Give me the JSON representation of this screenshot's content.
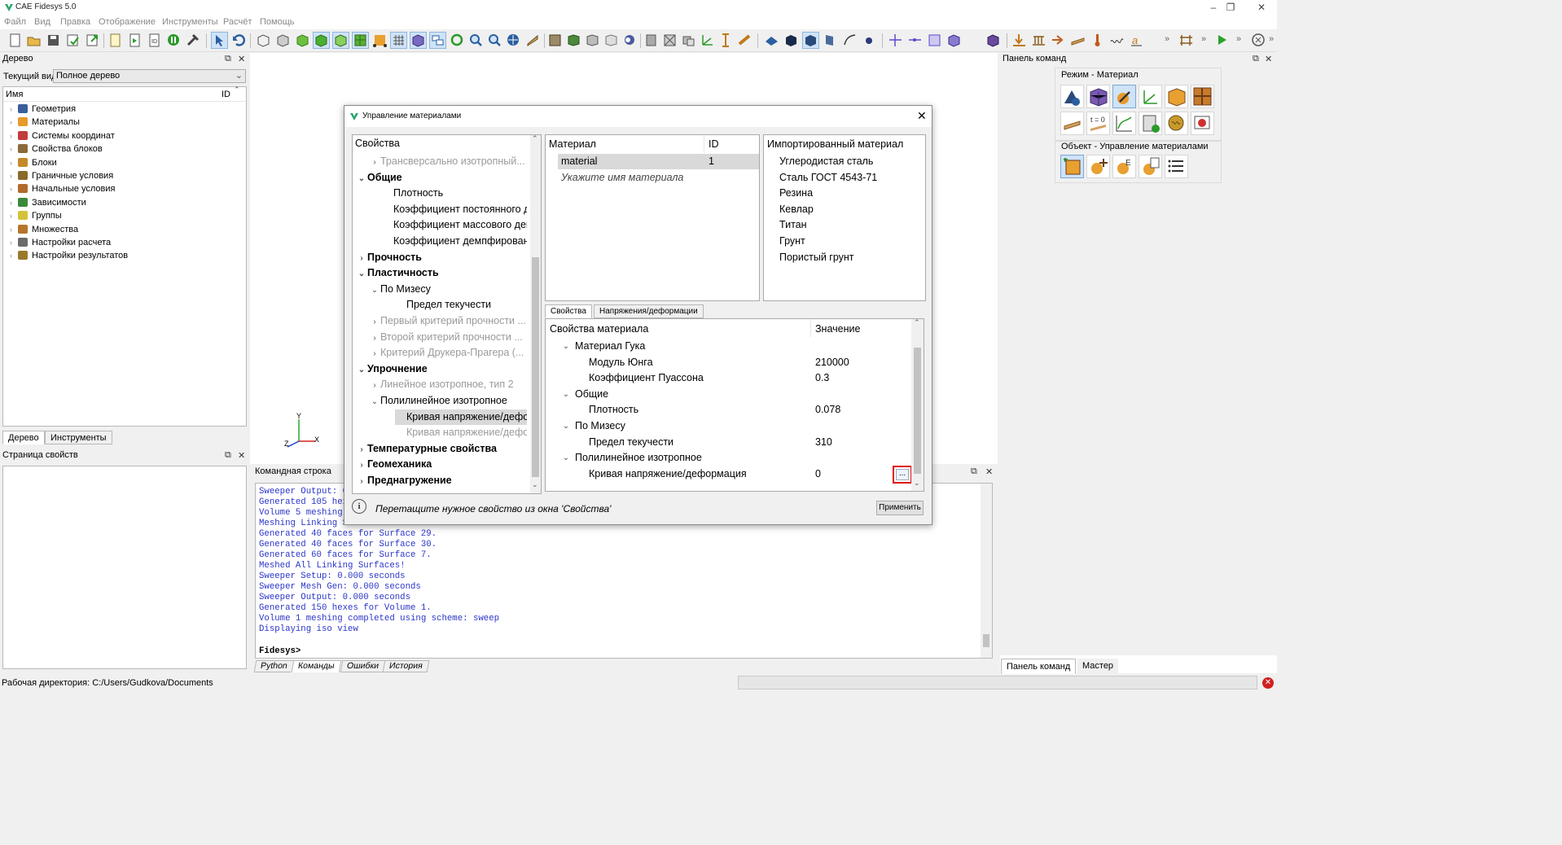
{
  "app": {
    "title": "CAE Fidesys 5.0"
  },
  "menu": [
    "Файл",
    "Вид",
    "Правка",
    "Отображение",
    "Инструменты",
    "Расчёт",
    "Помощь"
  ],
  "tree_dock": {
    "title": "Дерево",
    "current_view_label": "Текущий вид",
    "current_view_value": "Полное дерево",
    "col_name": "Имя",
    "col_id": "ID",
    "items": [
      {
        "label": "Геометрия",
        "icon": "geometry-icon",
        "color": "#3a5f9a"
      },
      {
        "label": "Материалы",
        "icon": "materials-icon",
        "color": "#e89a2a"
      },
      {
        "label": "Системы координат",
        "icon": "coord-system-icon",
        "color": "#c23b3b"
      },
      {
        "label": "Свойства блоков",
        "icon": "block-props-icon",
        "color": "#8a6a3a"
      },
      {
        "label": "Блоки",
        "icon": "blocks-icon",
        "color": "#c48a2a"
      },
      {
        "label": "Граничные условия",
        "icon": "boundary-icon",
        "color": "#8a6a2a"
      },
      {
        "label": "Начальные условия",
        "icon": "initial-icon",
        "color": "#b06a2a"
      },
      {
        "label": "Зависимости",
        "icon": "dependency-icon",
        "color": "#3a8a3a"
      },
      {
        "label": "Группы",
        "icon": "groups-icon",
        "color": "#d4c23a"
      },
      {
        "label": "Множества",
        "icon": "sets-icon",
        "color": "#b5762a"
      },
      {
        "label": "Настройки расчета",
        "icon": "calc-settings-icon",
        "color": "#6a6a6a"
      },
      {
        "label": "Настройки результатов",
        "icon": "results-settings-icon",
        "color": "#9a7a2a"
      }
    ],
    "tabs": [
      "Дерево",
      "Инструменты"
    ]
  },
  "props_dock": {
    "title": "Страница свойств"
  },
  "dialog": {
    "title": "Управление материалами",
    "props_header": "Свойства",
    "props": [
      {
        "label": "Трансверсально изотропный...",
        "level": 1,
        "style": "gray",
        "exp": "›"
      },
      {
        "label": "Общие",
        "level": 0,
        "style": "bold",
        "exp": "⌄"
      },
      {
        "label": "Плотность",
        "level": 2,
        "style": "",
        "exp": ""
      },
      {
        "label": "Коэффициент постоянного де...",
        "level": 2,
        "style": "",
        "exp": ""
      },
      {
        "label": "Коэффициент массового дем...",
        "level": 2,
        "style": "",
        "exp": ""
      },
      {
        "label": "Коэффициент демпфировани...",
        "level": 2,
        "style": "",
        "exp": ""
      },
      {
        "label": "Прочность",
        "level": 0,
        "style": "bold",
        "exp": "›"
      },
      {
        "label": "Пластичность",
        "level": 0,
        "style": "bold",
        "exp": "⌄"
      },
      {
        "label": "По Мизесу",
        "level": 1,
        "style": "",
        "exp": "⌄"
      },
      {
        "label": "Предел текучести",
        "level": 3,
        "style": "",
        "exp": ""
      },
      {
        "label": "Первый критерий прочности ...",
        "level": 1,
        "style": "gray",
        "exp": "›"
      },
      {
        "label": "Второй критерий прочности ...",
        "level": 1,
        "style": "gray",
        "exp": "›"
      },
      {
        "label": "Критерий Друкера-Прагера (...",
        "level": 1,
        "style": "gray",
        "exp": "›"
      },
      {
        "label": "Упрочнение",
        "level": 0,
        "style": "bold",
        "exp": "⌄"
      },
      {
        "label": "Линейное изотропное, тип 2",
        "level": 1,
        "style": "gray",
        "exp": "›"
      },
      {
        "label": "Полилинейное изотропное",
        "level": 1,
        "style": "",
        "exp": "⌄"
      },
      {
        "label": "Кривая напряжение/дефо...",
        "level": 3,
        "style": "sel",
        "exp": ""
      },
      {
        "label": "Кривая напряжение/дефо...",
        "level": 3,
        "style": "gray",
        "exp": ""
      },
      {
        "label": "Температурные свойства",
        "level": 0,
        "style": "bold",
        "exp": "›"
      },
      {
        "label": "Геомеханика",
        "level": 0,
        "style": "bold",
        "exp": "›"
      },
      {
        "label": "Преднагружение",
        "level": 0,
        "style": "bold",
        "exp": "›"
      }
    ],
    "mat_header_name": "Материал",
    "mat_header_id": "ID",
    "material_name": "material",
    "material_id": "1",
    "material_placeholder": "Укажите имя материала",
    "imported_header": "Импортированный материал",
    "imported": [
      "Углеродистая сталь",
      "Сталь ГОСТ 4543-71",
      "Резина",
      "Кевлар",
      "Титан",
      "Грунт",
      "Пористый грунт"
    ],
    "tabs": [
      "Свойства",
      "Напряжения/деформации"
    ],
    "prop_col_name": "Свойства материала",
    "prop_col_value": "Значение",
    "prop_rows": [
      {
        "label": "Материал Гука",
        "level": 0,
        "value": "",
        "exp": "⌄"
      },
      {
        "label": "Модуль Юнга",
        "level": 1,
        "value": "210000",
        "exp": ""
      },
      {
        "label": "Коэффициент Пуассона",
        "level": 1,
        "value": "0.3",
        "exp": ""
      },
      {
        "label": "Общие",
        "level": 0,
        "value": "",
        "exp": "⌄"
      },
      {
        "label": "Плотность",
        "level": 1,
        "value": "0.078",
        "exp": ""
      },
      {
        "label": "По Мизесу",
        "level": 0,
        "value": "",
        "exp": "⌄"
      },
      {
        "label": "Предел текучести",
        "level": 1,
        "value": "310",
        "exp": ""
      },
      {
        "label": "Полилинейное изотропное",
        "level": 0,
        "value": "",
        "exp": "⌄"
      },
      {
        "label": "Кривая напряжение/деформация",
        "level": 1,
        "value": "0",
        "exp": ""
      }
    ],
    "ellipsis": "...",
    "hint": "Перетащите нужное свойство из окна 'Свойства'",
    "apply": "Применить"
  },
  "console": {
    "title": "Командная строка",
    "lines": [
      "Sweeper Output: 0.000 seconds",
      "Generated 105 hexes for Volume 5.",
      "Volume 5 meshing completed using scheme: sweep",
      "Meshing Linking Surfaces...",
      "Generated 40 faces for Surface 29.",
      "Generated 40 faces for Surface 30.",
      "Generated 60 faces for Surface 7.",
      "Meshed All Linking Surfaces!",
      "Sweeper Setup: 0.000 seconds",
      "Sweeper Mesh Gen: 0.000 seconds",
      "Sweeper Output: 0.000 seconds",
      "Generated 150 hexes for Volume 1.",
      "Volume 1 meshing completed using scheme: sweep",
      "Displaying iso view"
    ],
    "prompt": "Fidesys>",
    "tabs": [
      "Python",
      "Команды",
      "Ошибки",
      "История"
    ]
  },
  "cmd_panel": {
    "title": "Панель команд",
    "group1": "Режим - Материал",
    "group2": "Объект - Управление материалами",
    "tabs": [
      "Панель команд",
      "Мастер"
    ]
  },
  "axes": {
    "x": "X",
    "y": "Y",
    "z": "Z"
  },
  "status": {
    "workdir": "Рабочая директория: C:/Users/Gudkova/Documents"
  }
}
